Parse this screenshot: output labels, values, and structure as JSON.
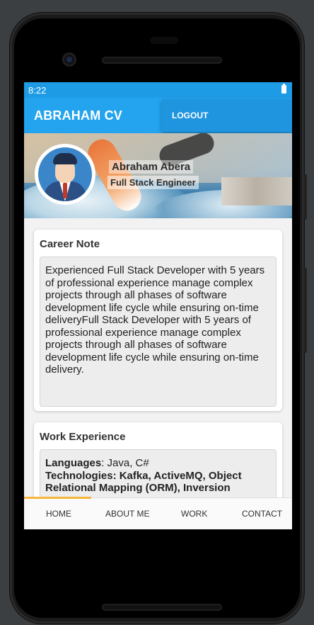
{
  "status": {
    "time": "8:22"
  },
  "appbar": {
    "title": "ABRAHAM CV",
    "logout_label": "LOGOUT"
  },
  "profile": {
    "name": "Abraham Abera",
    "role": "Full Stack Engineer"
  },
  "career_note": {
    "title": "Career Note",
    "text": "Experienced Full Stack Developer with 5 years of professional experience manage complex projects through all phases of software development life cycle while ensuring on-time deliveryFull Stack Developer with 5 years of professional experience manage complex projects through all phases of software development life cycle while ensuring on-time delivery."
  },
  "work_experience": {
    "title": "Work Experience",
    "languages_label": "Languages",
    "languages_value": ": Java, C#",
    "technologies_label": "Technologies: Kafka, ActiveMQ, Object Relational Mapping (ORM), Inversion"
  },
  "bottom_nav": {
    "items": [
      {
        "label": "HOME",
        "selected": true
      },
      {
        "label": "ABOUT ME"
      },
      {
        "label": "WORK"
      },
      {
        "label": "CONTACT"
      }
    ]
  },
  "colors": {
    "app_bar": "#24a3ee",
    "status_bar": "#1e9be5",
    "nav_indicator": "#f6b73c",
    "background": "#f2f2f2"
  },
  "icons": [
    "battery-icon",
    "avatar-icon",
    "camera-icon"
  ]
}
